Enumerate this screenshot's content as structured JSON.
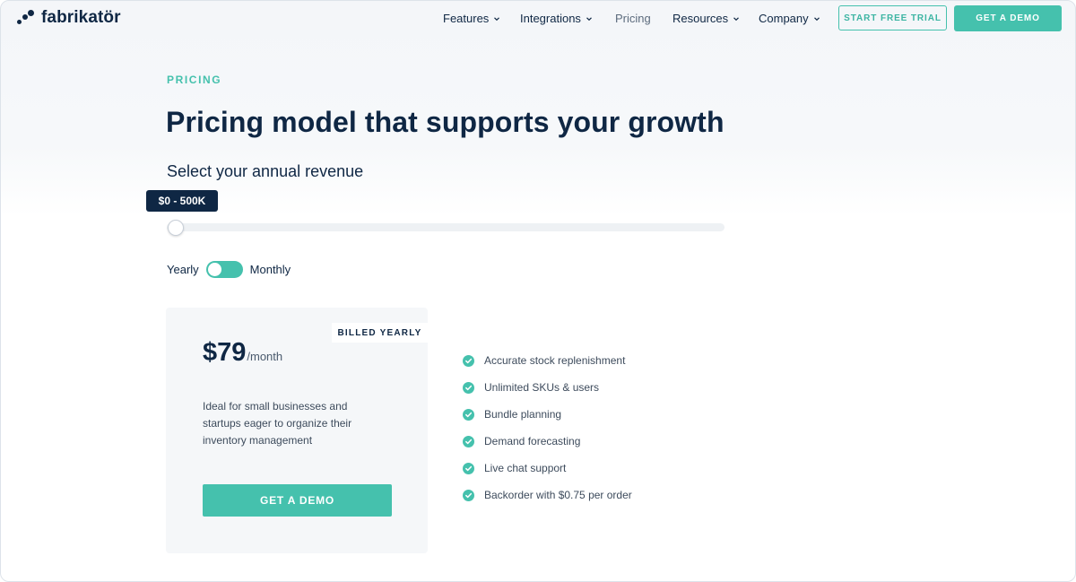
{
  "brand": {
    "name": "fabrikatör"
  },
  "nav": {
    "features": "Features",
    "integrations": "Integrations",
    "pricing": "Pricing",
    "resources": "Resources",
    "company": "Company"
  },
  "header_buttons": {
    "trial": "START FREE TRIAL",
    "demo": "GET A DEMO"
  },
  "hero": {
    "eyebrow": "PRICING",
    "title": "Pricing model that supports your growth",
    "subtitle": "Select your annual revenue"
  },
  "revenue_slider": {
    "value_label": "$0 - 500K",
    "position": 0
  },
  "billing": {
    "yearly_label": "Yearly",
    "monthly_label": "Monthly"
  },
  "plan": {
    "badge": "BILLED YEARLY",
    "price": "$79",
    "period": "/month",
    "description": "Ideal for small businesses and startups eager to organize their inventory management",
    "cta": "GET A DEMO"
  },
  "features": [
    "Accurate stock replenishment",
    "Unlimited SKUs & users",
    "Bundle planning",
    "Demand forecasting",
    "Live chat support",
    "Backorder with $0.75 per order"
  ],
  "colors": {
    "accent": "#45c1ad",
    "navy": "#0f2744"
  }
}
